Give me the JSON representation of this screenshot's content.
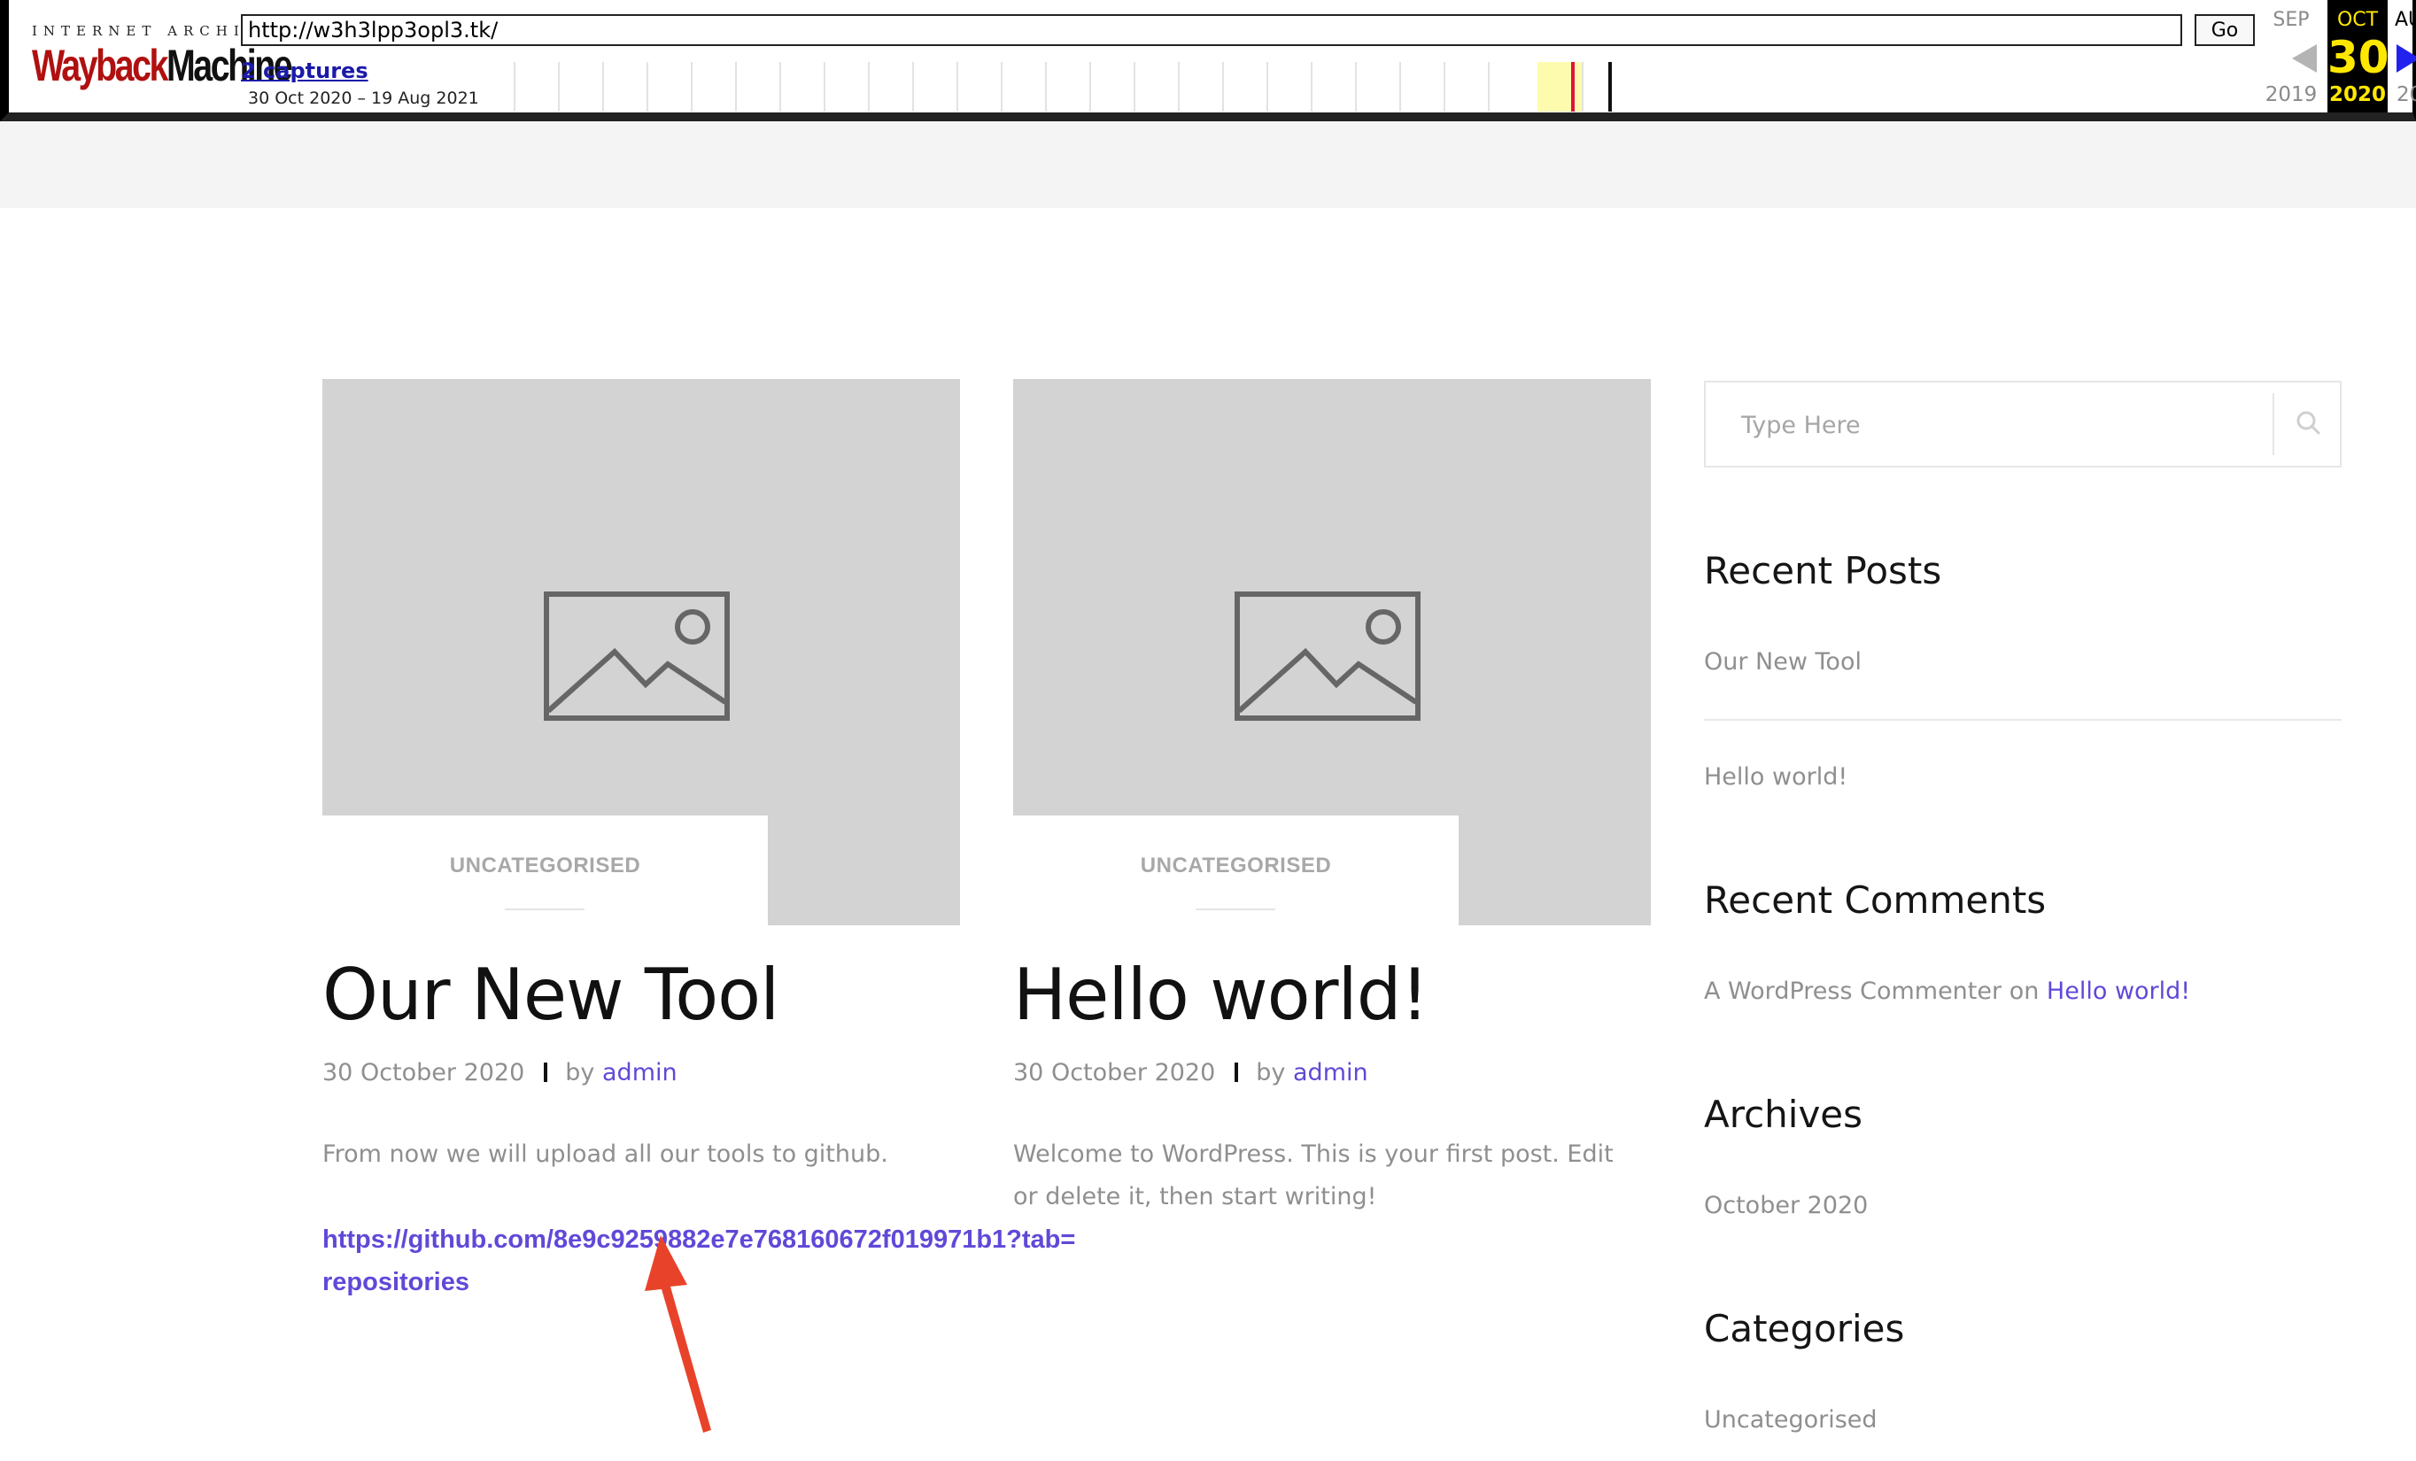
{
  "wayback": {
    "brand_top": "INTERNET ARCHIVE",
    "brand_wayback": "Wayback",
    "brand_machine": "Machine",
    "url": "http://w3h3lpp3opl3.tk/",
    "go_label": "Go",
    "captures_label": "2 captures",
    "date_range": "30 Oct 2020 – 19 Aug 2021",
    "prev": {
      "month": "SEP",
      "year": "2019"
    },
    "current": {
      "month": "OCT",
      "day": "30",
      "year": "2020"
    },
    "next": {
      "month": "AU",
      "year": "20"
    }
  },
  "posts": [
    {
      "category": "UNCATEGORISED",
      "title": "Our New Tool",
      "date": "30 October 2020",
      "by": "by",
      "author": "admin",
      "excerpt": "From now we will upload all our tools to github.",
      "link": "https://github.com/8e9c9259882e7e768160672f019971b1?tab=repositories"
    },
    {
      "category": "UNCATEGORISED",
      "title": "Hello world!",
      "date": "30 October 2020",
      "by": "by",
      "author": "admin",
      "excerpt": "Welcome to WordPress. This is your first post. Edit or delete it, then start writing!"
    }
  ],
  "sidebar": {
    "search_placeholder": "Type Here",
    "recent_posts": {
      "title": "Recent Posts",
      "items": [
        "Our New Tool",
        "Hello world!"
      ]
    },
    "recent_comments": {
      "title": "Recent Comments",
      "author": "A WordPress Commenter",
      "on": "on",
      "post": "Hello world!"
    },
    "archives": {
      "title": "Archives",
      "items": [
        "October 2020"
      ]
    },
    "categories": {
      "title": "Categories",
      "items": [
        "Uncategorised"
      ]
    }
  },
  "colors": {
    "accent_link": "#6049d8",
    "wayback_highlight": "#ffe800",
    "annotation_arrow": "#e8432a"
  }
}
